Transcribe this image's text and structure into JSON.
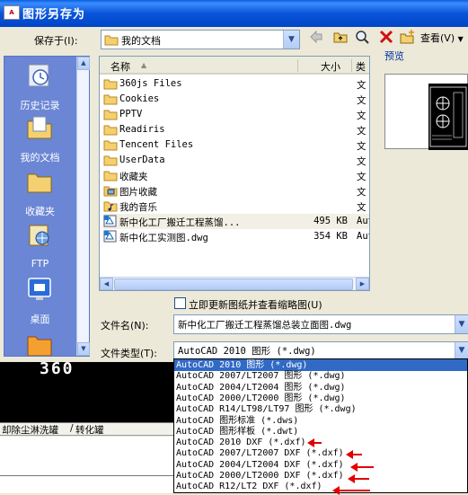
{
  "window": {
    "title": "图形另存为",
    "icon": "autocad-app-icon"
  },
  "savein": {
    "label": "保存于(I):",
    "value": "我的文档"
  },
  "toolbar": {
    "views_label": "查看(V)"
  },
  "places": [
    {
      "label": "历史记录",
      "icon": "history-icon"
    },
    {
      "label": "我的文档",
      "icon": "my-documents-icon"
    },
    {
      "label": "收藏夹",
      "icon": "favorites-icon"
    },
    {
      "label": "FTP",
      "icon": "ftp-icon"
    },
    {
      "label": "桌面",
      "icon": "desktop-icon"
    }
  ],
  "filelist": {
    "columns": {
      "name": "名称",
      "size": "大小",
      "type": "类"
    },
    "rows": [
      {
        "name": "360js Files",
        "size": "",
        "type": "文",
        "icon": "folder"
      },
      {
        "name": "Cookies",
        "size": "",
        "type": "文",
        "icon": "folder"
      },
      {
        "name": "PPTV",
        "size": "",
        "type": "文",
        "icon": "folder"
      },
      {
        "name": "Readiris",
        "size": "",
        "type": "文",
        "icon": "folder"
      },
      {
        "name": "Tencent Files",
        "size": "",
        "type": "文",
        "icon": "folder"
      },
      {
        "name": "UserData",
        "size": "",
        "type": "文",
        "icon": "folder"
      },
      {
        "name": "收藏夹",
        "size": "",
        "type": "文",
        "icon": "folder"
      },
      {
        "name": "图片收藏",
        "size": "",
        "type": "文",
        "icon": "pictures-folder"
      },
      {
        "name": "我的音乐",
        "size": "",
        "type": "文",
        "icon": "music-folder"
      },
      {
        "name": "新中化工厂搬迁工程蒸馏...",
        "size": "495 KB",
        "type": "Aut",
        "icon": "dwg"
      },
      {
        "name": "新中化工实测图.dwg",
        "size": "354 KB",
        "type": "Aut",
        "icon": "dwg"
      }
    ]
  },
  "preview": {
    "label": "预览"
  },
  "thumbnail_option": {
    "label": "立即更新图纸并查看缩略图(U)",
    "checked": false
  },
  "filename": {
    "label": "文件名(N):",
    "value": "新中化工厂搬迁工程蒸馏总装立面图.dwg"
  },
  "filetype": {
    "label": "文件类型(T):",
    "value": "AutoCAD 2010 图形 (*.dwg)",
    "options": [
      "AutoCAD 2010 图形 (*.dwg)",
      "AutoCAD 2007/LT2007 图形 (*.dwg)",
      "AutoCAD 2004/LT2004 图形 (*.dwg)",
      "AutoCAD 2000/LT2000 图形 (*.dwg)",
      "AutoCAD R14/LT98/LT97 图形 (*.dwg)",
      "AutoCAD 图形标准 (*.dws)",
      "AutoCAD 图形样板 (*.dwt)",
      "AutoCAD 2010 DXF (*.dxf)",
      "AutoCAD 2007/LT2007 DXF (*.dxf)",
      "AutoCAD 2004/LT2004 DXF (*.dxf)",
      "AutoCAD 2000/LT2000 DXF (*.dxf)",
      "AutoCAD R12/LT2 DXF (*.dxf)"
    ],
    "selected_index": 0,
    "highlight_color": "#316ac5",
    "annotation_color": "#e00000"
  },
  "background": {
    "canvas_text": "360",
    "tabs": [
      "却除尘淋洗罐",
      "转化罐"
    ]
  }
}
